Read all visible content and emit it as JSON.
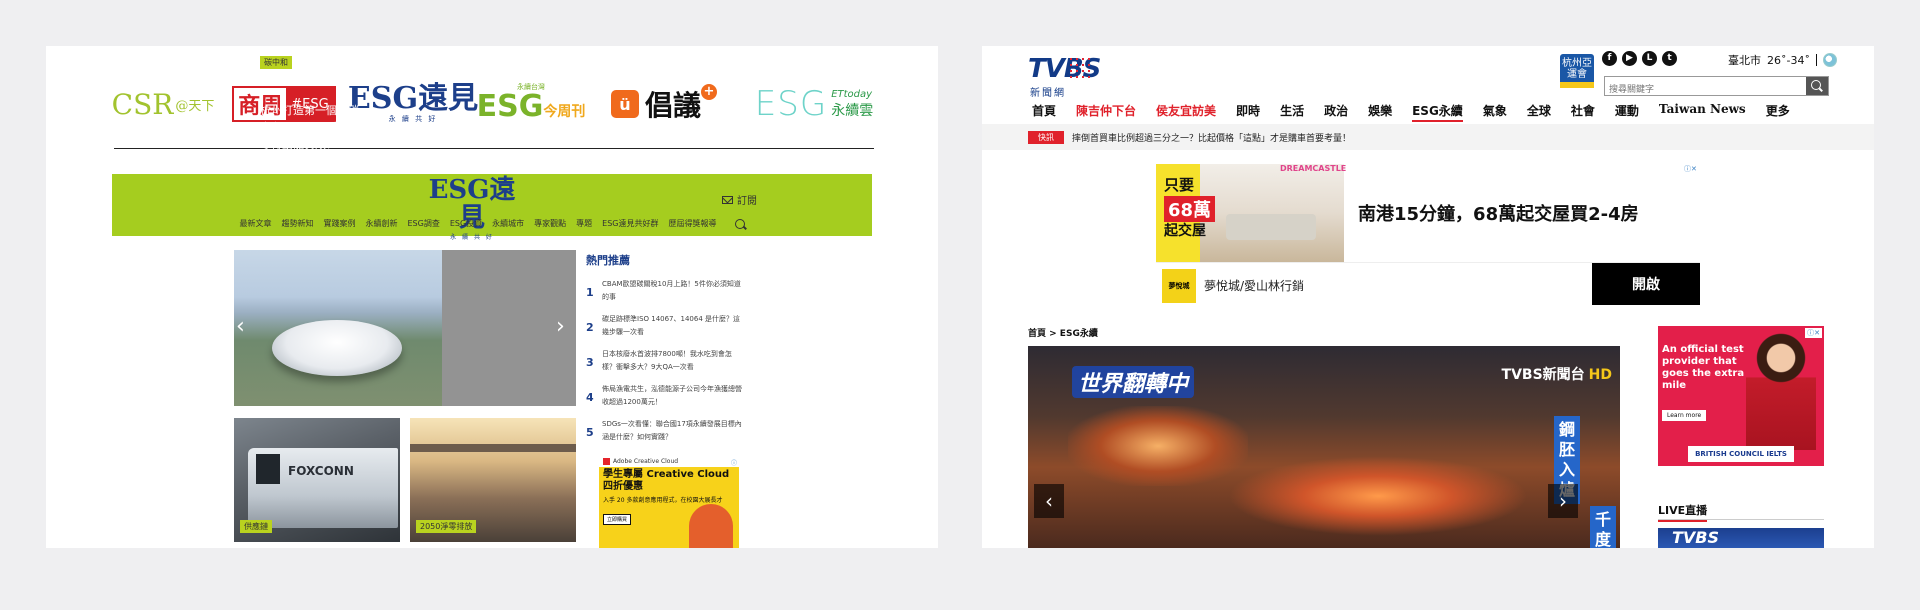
{
  "left": {
    "logos": {
      "csr": {
        "main": "CSR",
        "suffix": "@天下"
      },
      "shangzhou": {
        "main": "商周",
        "badge": "#ESG"
      },
      "yuanjian": {
        "main": "ESG遠見",
        "sub": "永 續 共 好"
      },
      "esg_jin": {
        "main": "ESG",
        "accent": "今周刊",
        "sub": "永續台灣"
      },
      "changyi": {
        "main": "倡議",
        "plus": "+",
        "icon": "ü"
      },
      "ettoday": {
        "main": "ESG",
        "sub1": "ETtoday",
        "sub2": "永續雲"
      }
    },
    "esg_header": {
      "logo": "ESG遠見",
      "logo_sub": "永 續 共 好",
      "subscribe": "訂閱",
      "nav": [
        "最新文章",
        "趨勢新知",
        "實踐案例",
        "永續創新",
        "ESG調查",
        "ESG投資",
        "永續城市",
        "專家觀點",
        "專題",
        "ESG遠見共好群",
        "歷屆得獎報導"
      ]
    },
    "hero": {
      "tag": "碳中和",
      "title": "杭州打造第一個「碳中和」亞運！5招淨零行動能奏效？"
    },
    "thumbs": [
      {
        "tag": "供應鏈",
        "brand": "FOXCONN"
      },
      {
        "tag": "2050淨零排放"
      }
    ],
    "hot": {
      "title": "熱門推薦",
      "items": [
        {
          "num": "1",
          "text": "CBAM歐盟碳關稅10月上路！5件你必須知道的事"
        },
        {
          "num": "2",
          "text": "碳足跡標準ISO 14067、14064 是什麼？這幾步驟一次看"
        },
        {
          "num": "3",
          "text": "日本核廢水首波排7800噸！我水吃到會怎樣？衝擊多大？9大QA一次看"
        },
        {
          "num": "4",
          "text": "佈局漁電共生，泓德能源子公司今年漁獲總營收超過1200萬元！"
        },
        {
          "num": "5",
          "text": "SDGs一次看懂：聯合國17項永續發展目標內涵是什麼？如何實踐？"
        }
      ]
    },
    "ad": {
      "brand": "Adobe Creative Cloud",
      "headline": "學生專屬 Creative Cloud 四折優惠",
      "sub": "入手 20 多款創意應用程式，在校園大展長才",
      "cta": "立即購買",
      "info": "ⓘ"
    }
  },
  "right": {
    "logo": {
      "main": "TVBS",
      "sub": "新聞網"
    },
    "hz_logo": "杭州亞運會",
    "socials": [
      "f",
      "▶",
      "L",
      "t"
    ],
    "weather": {
      "city": "臺北市",
      "temp": "26˚-34˚"
    },
    "search": {
      "placeholder": "搜尋關鍵字"
    },
    "nav": [
      "首頁",
      "陳吉仲下台",
      "侯友宜訪美",
      "即時",
      "生活",
      "政治",
      "娛樂",
      "ESG永續",
      "氣象",
      "全球",
      "社會",
      "運動",
      "Taiwan News",
      "更多"
    ],
    "ticker": {
      "badge": "快訊",
      "text": "摔倒首買車比例超過三分之一？比起價格「這點」才是購車首要考量！"
    },
    "ad_top": {
      "brand": "DREAMCASTLE",
      "price_line1": "只要",
      "price_num": "68萬",
      "price_line2": "起交屋",
      "headline": "南港15分鐘，68萬起交屋買2-4房",
      "bar_logo": "夢悅城",
      "bar_text": "夢悅城/愛山林行銷",
      "open": "開啟",
      "close": "ⓘ✕"
    },
    "breadcrumb": "首頁 > ESG永續",
    "video": {
      "logo_left": "世界翻轉中",
      "logo_right": "TVBS新聞台",
      "hd": "HD",
      "side1": "鋼胚入爐",
      "side2": "千度高"
    },
    "ielts_ad": {
      "text": "An official test provider that goes the extra mile",
      "learn": "Learn more",
      "footer": "BRITISH COUNCIL  IELTS",
      "close": "ⓘ✕"
    },
    "live": {
      "title": "LIVE直播",
      "thumb": "TVBS"
    }
  }
}
